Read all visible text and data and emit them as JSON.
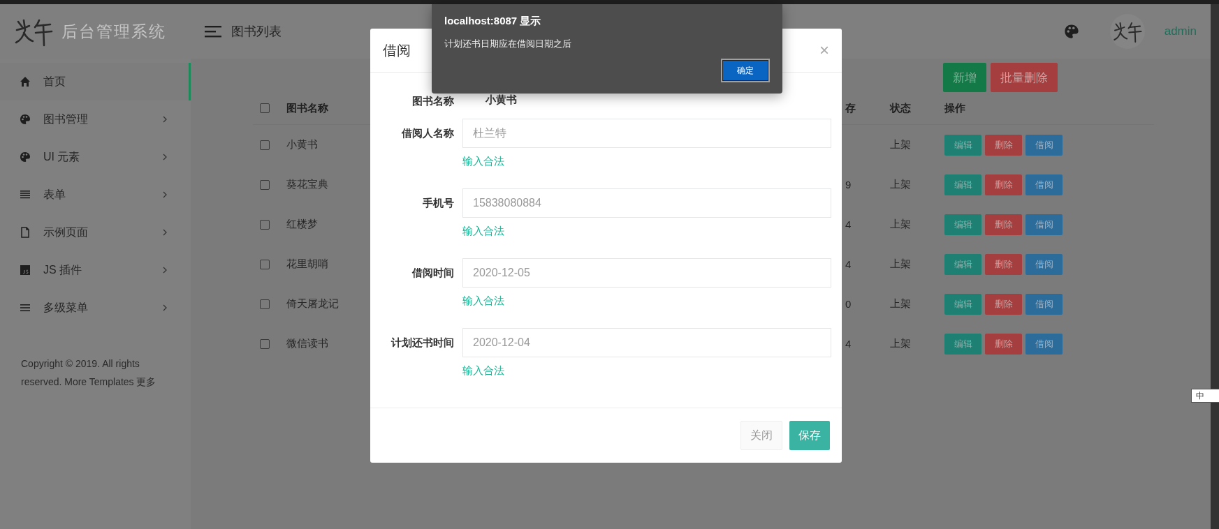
{
  "brand": {
    "subtitle": "后台管理系统"
  },
  "topbar": {
    "title": "图书列表",
    "user": "admin"
  },
  "sidebar": {
    "items": [
      {
        "label": "首页",
        "kind": "home",
        "selected": true,
        "has_children": false
      },
      {
        "label": "图书管理",
        "kind": "palette",
        "selected": false,
        "has_children": true
      },
      {
        "label": "UI 元素",
        "kind": "palette",
        "selected": false,
        "has_children": true
      },
      {
        "label": "表单",
        "kind": "lines",
        "selected": false,
        "has_children": true
      },
      {
        "label": "示例页面",
        "kind": "file",
        "selected": false,
        "has_children": true
      },
      {
        "label": "JS 插件",
        "kind": "js",
        "selected": false,
        "has_children": true
      },
      {
        "label": "多级菜单",
        "kind": "bars",
        "selected": false,
        "has_children": true
      }
    ],
    "footer": "Copyright © 2019. All rights reserved. More Templates 更多"
  },
  "toolbar": {
    "buttons": [
      {
        "label": "新增",
        "kind": "add"
      },
      {
        "label": "批量删除",
        "kind": "delete"
      }
    ]
  },
  "table": {
    "all_checked": false,
    "columns": [
      "图书名称",
      "存",
      "状态",
      "操作"
    ],
    "rows": [
      {
        "name": "小黄书",
        "column_2": "",
        "status": "上架",
        "checked": false,
        "actions": [
          {
            "label": "编辑",
            "kind": "edit"
          },
          {
            "label": "删除",
            "kind": "delete"
          },
          {
            "label": "借阅",
            "kind": "borrow"
          }
        ]
      },
      {
        "name": "葵花宝典",
        "column_2": "9",
        "status": "上架",
        "checked": false,
        "actions": [
          {
            "label": "编辑",
            "kind": "edit"
          },
          {
            "label": "删除",
            "kind": "delete"
          },
          {
            "label": "借阅",
            "kind": "borrow"
          }
        ]
      },
      {
        "name": "红楼梦",
        "column_2": "4",
        "status": "上架",
        "checked": false,
        "actions": [
          {
            "label": "编辑",
            "kind": "edit"
          },
          {
            "label": "删除",
            "kind": "delete"
          },
          {
            "label": "借阅",
            "kind": "borrow"
          }
        ]
      },
      {
        "name": "花里胡哨",
        "column_2": "4",
        "status": "上架",
        "checked": false,
        "actions": [
          {
            "label": "编辑",
            "kind": "edit"
          },
          {
            "label": "删除",
            "kind": "delete"
          },
          {
            "label": "借阅",
            "kind": "borrow"
          }
        ]
      },
      {
        "name": "倚天屠龙记",
        "column_2": "0",
        "status": "上架",
        "checked": false,
        "actions": [
          {
            "label": "编辑",
            "kind": "edit"
          },
          {
            "label": "删除",
            "kind": "delete"
          },
          {
            "label": "借阅",
            "kind": "borrow"
          }
        ]
      },
      {
        "name": "微信读书",
        "column_2": "4",
        "status": "上架",
        "checked": false,
        "actions": [
          {
            "label": "编辑",
            "kind": "edit"
          },
          {
            "label": "删除",
            "kind": "delete"
          },
          {
            "label": "借阅",
            "kind": "borrow"
          }
        ]
      }
    ]
  },
  "modal": {
    "title": "借阅",
    "close": "×",
    "fields": [
      {
        "label": "图书名称",
        "kind": "static",
        "value": "小黄书"
      },
      {
        "label": "借阅人名称",
        "kind": "input",
        "value": "杜兰特",
        "hint": "输入合法"
      },
      {
        "label": "手机号",
        "kind": "input",
        "value": "15838080884",
        "hint": "输入合法"
      },
      {
        "label": "借阅时间",
        "kind": "input",
        "value": "2020-12-05",
        "hint": "输入合法"
      },
      {
        "label": "计划还书时间",
        "kind": "input",
        "value": "2020-12-04",
        "hint": "输入合法"
      }
    ],
    "buttons": [
      {
        "label": "关闭",
        "kind": "close"
      },
      {
        "label": "保存",
        "kind": "save"
      }
    ]
  },
  "alert": {
    "title": "localhost:8087 显示",
    "message": "计划还书日期应在借阅日期之后",
    "button": "确定"
  },
  "ime": {
    "label": "中"
  }
}
